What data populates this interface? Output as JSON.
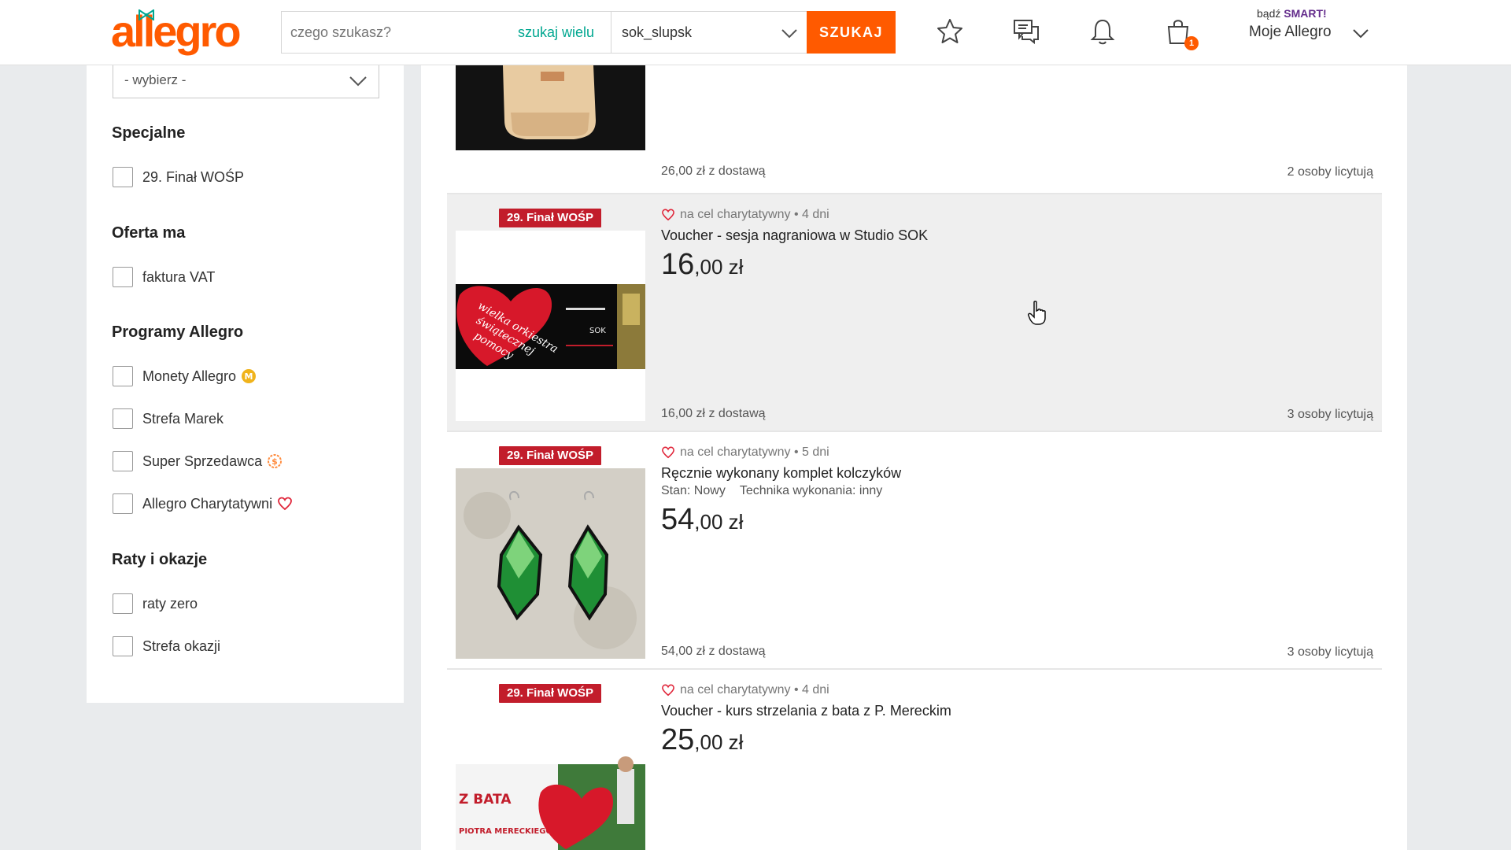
{
  "header": {
    "logo": "allegro",
    "search_placeholder": "czego szukasz?",
    "search_many": "szukaj wielu",
    "search_category": "sok_slupsk",
    "search_button": "SZUKAJ",
    "cart_count": "1",
    "smart_prefix": "bądź",
    "smart_word": "SMART!",
    "account_label": "Moje Allegro",
    "brand_color": "#ff5a00"
  },
  "sidebar": {
    "select_value": "- wybierz -",
    "sections": [
      {
        "title": "Specjalne",
        "options": [
          "29. Finał WOŚP"
        ]
      },
      {
        "title": "Oferta ma",
        "options": [
          "faktura VAT"
        ]
      },
      {
        "title": "Programy Allegro",
        "options": [
          "Monety Allegro",
          "Strefa Marek",
          "Super Sprzedawca",
          "Allegro Charytatywni"
        ]
      },
      {
        "title": "Raty i okazje",
        "options": [
          "raty zero",
          "Strefa okazji"
        ]
      }
    ]
  },
  "listing": [
    {
      "delivery": "26,00 zł z dostawą",
      "bidders": "2 osoby licytują"
    },
    {
      "badge": "29. Finał WOŚP",
      "charity": "na cel charytatywny • 4 dni",
      "title": "Voucher - sesja nagraniowa w Studio SOK",
      "price_int": "16",
      "price_dec": ",00 zł",
      "delivery": "16,00 zł z dostawą",
      "bidders": "3 osoby licytują",
      "thumb_text": "wielka orkiestra świątecznej pomocy"
    },
    {
      "badge": "29. Finał WOŚP",
      "charity": "na cel charytatywny • 5 dni",
      "title": "Ręcznie wykonany komplet kolczyków",
      "param_state": "Stan: Nowy",
      "param_technique": "Technika wykonania: inny",
      "price_int": "54",
      "price_dec": ",00 zł",
      "delivery": "54,00 zł z dostawą",
      "bidders": "3 osoby licytują"
    },
    {
      "badge": "29. Finał WOŚP",
      "charity": "na cel charytatywny • 4 dni",
      "title": "Voucher - kurs strzelania z bata z P. Mereckim",
      "price_int": "25",
      "price_dec": ",00 zł",
      "thumb_line1": "Z BATA",
      "thumb_line2": "PIOTRA MERECKIEGO"
    }
  ]
}
